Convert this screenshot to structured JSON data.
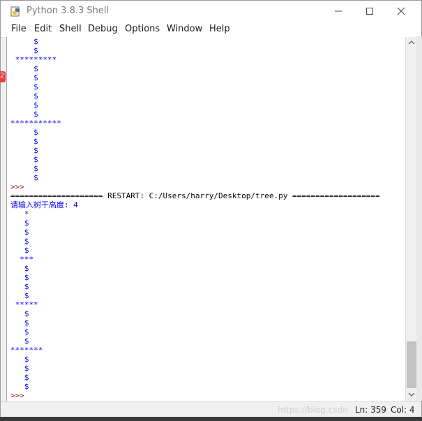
{
  "window": {
    "title": "Python 3.8.3 Shell"
  },
  "menu": [
    "File",
    "Edit",
    "Shell",
    "Debug",
    "Options",
    "Window",
    "Help"
  ],
  "shell_lines": [
    {
      "text": "     $",
      "kind": "out"
    },
    {
      "text": "     $",
      "kind": "out"
    },
    {
      "text": " *********",
      "kind": "out"
    },
    {
      "text": "     $",
      "kind": "out"
    },
    {
      "text": "     $",
      "kind": "out"
    },
    {
      "text": "     $",
      "kind": "out"
    },
    {
      "text": "     $",
      "kind": "out"
    },
    {
      "text": "     $",
      "kind": "out"
    },
    {
      "text": "     $",
      "kind": "out"
    },
    {
      "text": "***********",
      "kind": "out"
    },
    {
      "text": "     $",
      "kind": "out"
    },
    {
      "text": "     $",
      "kind": "out"
    },
    {
      "text": "     $",
      "kind": "out"
    },
    {
      "text": "     $",
      "kind": "out"
    },
    {
      "text": "     $",
      "kind": "out"
    },
    {
      "text": "     $",
      "kind": "out"
    },
    {
      "text": ">>> ",
      "kind": "prompt"
    },
    {
      "text": "==================== RESTART: C:/Users/harry/Desktop/tree.py ===================",
      "kind": "restart"
    },
    {
      "text": "请输入树干高度: 4",
      "kind": "out"
    },
    {
      "text": "   *",
      "kind": "out"
    },
    {
      "text": "   $",
      "kind": "out"
    },
    {
      "text": "   $",
      "kind": "out"
    },
    {
      "text": "   $",
      "kind": "out"
    },
    {
      "text": "   $",
      "kind": "out"
    },
    {
      "text": "  ***",
      "kind": "out"
    },
    {
      "text": "   $",
      "kind": "out"
    },
    {
      "text": "   $",
      "kind": "out"
    },
    {
      "text": "   $",
      "kind": "out"
    },
    {
      "text": "   $",
      "kind": "out"
    },
    {
      "text": " *****",
      "kind": "out"
    },
    {
      "text": "   $",
      "kind": "out"
    },
    {
      "text": "   $",
      "kind": "out"
    },
    {
      "text": "   $",
      "kind": "out"
    },
    {
      "text": "   $",
      "kind": "out"
    },
    {
      "text": "*******",
      "kind": "out"
    },
    {
      "text": "   $",
      "kind": "out"
    },
    {
      "text": "   $",
      "kind": "out"
    },
    {
      "text": "   $",
      "kind": "out"
    },
    {
      "text": "   $",
      "kind": "out"
    },
    {
      "text": ">>> ",
      "kind": "prompt"
    }
  ],
  "status": {
    "watermark": "https://blog.csdn",
    "ln": "Ln: 359",
    "col": "Col: 4"
  },
  "background": {
    "badge": "2"
  },
  "icons": {
    "app": "python-idle-icon",
    "minimize": "minimize-icon",
    "maximize": "maximize-icon",
    "close": "close-icon"
  },
  "colors": {
    "output": "#0000ff",
    "prompt": "#a02020",
    "restart": "#000000"
  }
}
